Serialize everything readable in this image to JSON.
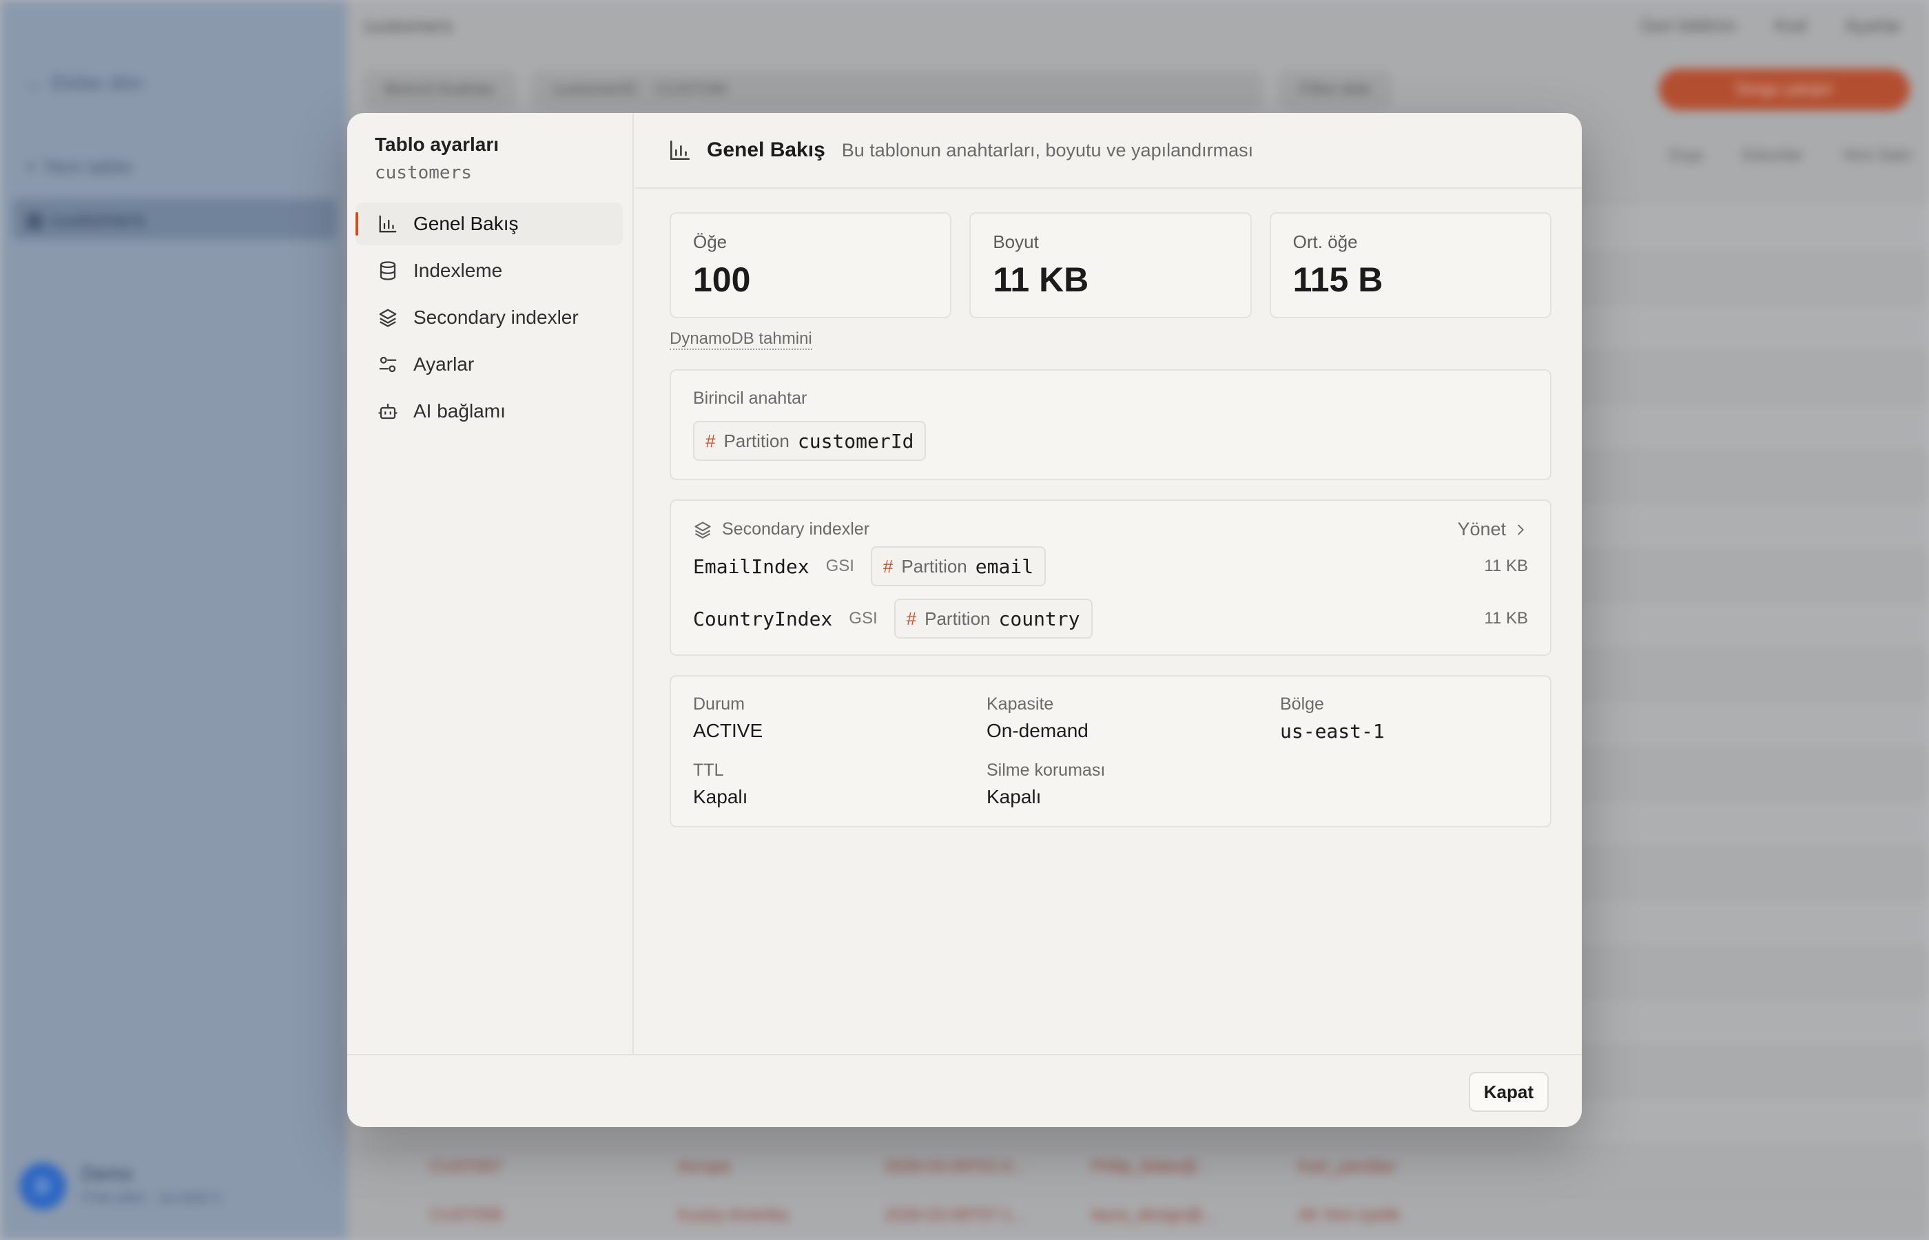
{
  "background": {
    "sidebar": {
      "back_link": "Ekibe dön",
      "new_table": "Yeni tablo",
      "active_table": "customers",
      "user": {
        "initial": "D",
        "name": "Demo",
        "subtitle": "Free plan · us-east-1"
      }
    },
    "header": {
      "title": "customers",
      "actions": [
        "Geri bildirim",
        "Kod",
        "Ayarlar"
      ]
    },
    "toolbar": {
      "index_select": "Birincil Anahtar",
      "table_select": "customerID",
      "key_select": "CUSTOM",
      "filter": "Filtre ekle",
      "primary_button": "Sorgu çalıştır"
    },
    "table_actions": [
      "Dışa",
      "Sütunlar",
      "Yeni Satır"
    ],
    "rows": [
      [
        "CUST007",
        "Avrupa",
        "2026-03-09T01:0...",
        "Philip_blake@..",
        "Kart_yanıtları"
      ],
      [
        "CUST006",
        "Kuzey Amerika",
        "2026-03-08T07:1...",
        "laura_design@...",
        "Alt Yeni üyelik"
      ]
    ]
  },
  "modal": {
    "title": "Tablo ayarları",
    "subtitle": "customers",
    "nav": [
      {
        "label": "Genel Bakış",
        "icon": "bar-chart-icon"
      },
      {
        "label": "Indexleme",
        "icon": "database-icon"
      },
      {
        "label": "Secondary indexler",
        "icon": "layers-icon"
      },
      {
        "label": "Ayarlar",
        "icon": "sliders-icon"
      },
      {
        "label": "AI bağlamı",
        "icon": "bot-icon"
      }
    ],
    "header": {
      "title": "Genel Bakış",
      "description": "Bu tablonun anahtarları, boyutu ve yapılandırması"
    },
    "stats": [
      {
        "label": "Öğe",
        "value": "100"
      },
      {
        "label": "Boyut",
        "value": "11 KB"
      },
      {
        "label": "Ort. öğe",
        "value": "115 B"
      }
    ],
    "estimate_note": "DynamoDB tahmini",
    "primary_key": {
      "label": "Birincil anahtar",
      "hash": "#",
      "type": "Partition",
      "name": "customerId"
    },
    "secondary_indexes": {
      "label": "Secondary indexler",
      "manage": "Yönet",
      "items": [
        {
          "name": "EmailIndex",
          "kind": "GSI",
          "hash": "#",
          "key_type": "Partition",
          "key_name": "email",
          "size": "11 KB"
        },
        {
          "name": "CountryIndex",
          "kind": "GSI",
          "hash": "#",
          "key_type": "Partition",
          "key_name": "country",
          "size": "11 KB"
        }
      ]
    },
    "properties": {
      "status_label": "Durum",
      "status_value": "ACTIVE",
      "capacity_label": "Kapasite",
      "capacity_value": "On-demand",
      "region_label": "Bölge",
      "region_value": "us-east-1",
      "ttl_label": "TTL",
      "ttl_value": "Kapalı",
      "deletion_label": "Silme koruması",
      "deletion_value": "Kapalı"
    },
    "close_button": "Kapat"
  },
  "colors": {
    "accent": "#d44b1f",
    "modal_bg": "#f3f2ee",
    "card_border": "#e4e2dc"
  }
}
